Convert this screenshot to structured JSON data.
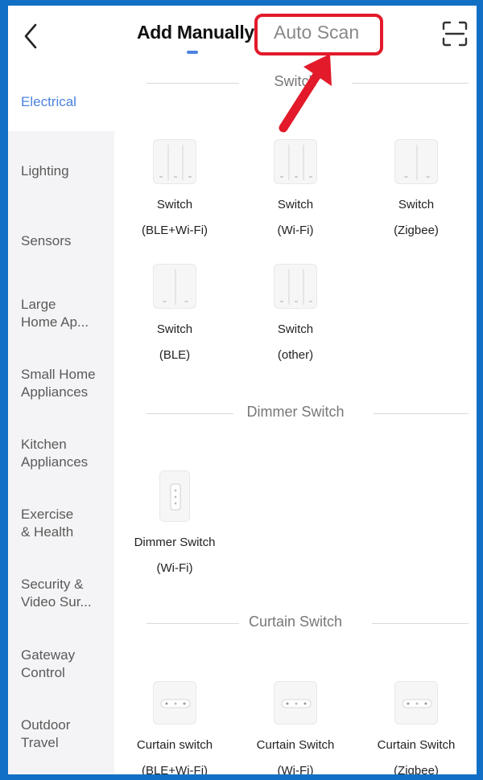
{
  "header": {
    "tab_manual": "Add Manually",
    "tab_auto": "Auto Scan",
    "back_icon": "chevron-left-icon",
    "scan_icon": "scan-frame-icon"
  },
  "annotation": {
    "color": "#e21a2a"
  },
  "colors": {
    "accent": "#4c82e0",
    "frame": "#1170c4"
  },
  "sidebar": {
    "items": [
      {
        "label": "Electrical",
        "active": true
      },
      {
        "label": "Lighting"
      },
      {
        "label": "Sensors"
      },
      {
        "label": "Large\nHome Ap..."
      },
      {
        "label": "Small Home\nAppliances"
      },
      {
        "label": "Kitchen\nAppliances"
      },
      {
        "label": "Exercise\n& Health"
      },
      {
        "label": "Security &\nVideo Sur..."
      },
      {
        "label": "Gateway\nControl"
      },
      {
        "label": "Outdoor\nTravel"
      }
    ]
  },
  "sections": [
    {
      "title": "Switch",
      "devices": [
        {
          "line1": "Switch",
          "line2": "(BLE+Wi-Fi)"
        },
        {
          "line1": "Switch",
          "line2": "(Wi-Fi)"
        },
        {
          "line1": "Switch",
          "line2": "(Zigbee)"
        },
        {
          "line1": "Switch",
          "line2": "(BLE)"
        },
        {
          "line1": "Switch",
          "line2": "(other)"
        }
      ]
    },
    {
      "title": "Dimmer Switch",
      "devices": [
        {
          "line1": "Dimmer Switch",
          "line2": "(Wi-Fi)"
        }
      ]
    },
    {
      "title": "Curtain Switch",
      "devices": [
        {
          "line1": "Curtain switch",
          "line2": "(BLE+Wi-Fi)"
        },
        {
          "line1": "Curtain Switch",
          "line2": "(Wi-Fi)"
        },
        {
          "line1": "Curtain Switch",
          "line2": "(Zigbee)"
        }
      ]
    }
  ]
}
